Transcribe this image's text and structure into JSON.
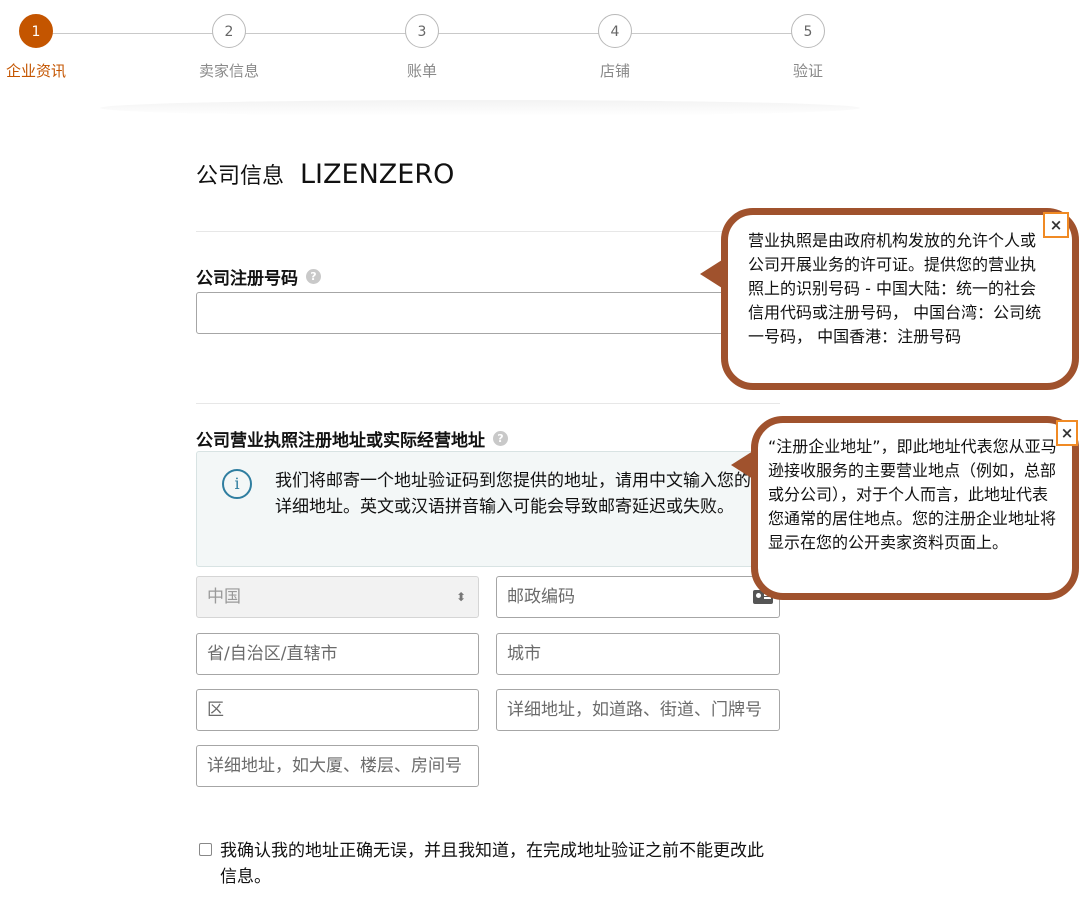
{
  "stepper": {
    "steps": [
      {
        "number": "1",
        "label": "企业资讯"
      },
      {
        "number": "2",
        "label": "卖家信息"
      },
      {
        "number": "3",
        "label": "账单"
      },
      {
        "number": "4",
        "label": "店铺"
      },
      {
        "number": "5",
        "label": "验证"
      }
    ],
    "active_step": 1
  },
  "company": {
    "label": "公司信息",
    "name": "LIZENZERO"
  },
  "registration_number": {
    "label": "公司注册号码",
    "value": ""
  },
  "address": {
    "label": "公司营业执照注册地址或实际经营地址",
    "info": "我们将邮寄一个地址验证码到您提供的地址，请用中文输入您的详细地址。英文或汉语拼音输入可能会导致邮寄延迟或失败。",
    "country": "中国",
    "postal_placeholder": "邮政编码",
    "province_placeholder": "省/自治区/直辖市",
    "city_placeholder": "城市",
    "district_placeholder": "区",
    "street_placeholder": "详细地址，如道路、街道、门牌号",
    "building_placeholder": "详细地址，如大厦、楼层、房间号"
  },
  "confirm": {
    "text": "我确认我的地址正确无误，并且我知道，在完成地址验证之前不能更改此信息。"
  },
  "tooltips": {
    "license": "营业执照是由政府机构发放的允许个人或公司开展业务的许可证。提供您的营业执照上的识别号码 - 中国大陆：统一的社会信用代码或注册号码， 中国台湾：公司统一号码， 中国香港：注册号码",
    "address": "“注册企业地址”，即此地址代表您从亚马逊接收服务的主要营业地点（例如，总部或分公司），对于个人而言，此地址代表您通常的居住地点。您的注册企业地址将显示在您的公开卖家资料页面上。",
    "close_symbol": "×"
  },
  "icons": {
    "help": "question-circle-icon",
    "info": "info-icon",
    "select": "sort-arrows-icon",
    "postal": "id-card-icon"
  },
  "colors": {
    "accent": "#c45500",
    "tooltip_border": "#a0522d",
    "close_border": "#f08a24",
    "info_blue": "#2f7ea0"
  }
}
